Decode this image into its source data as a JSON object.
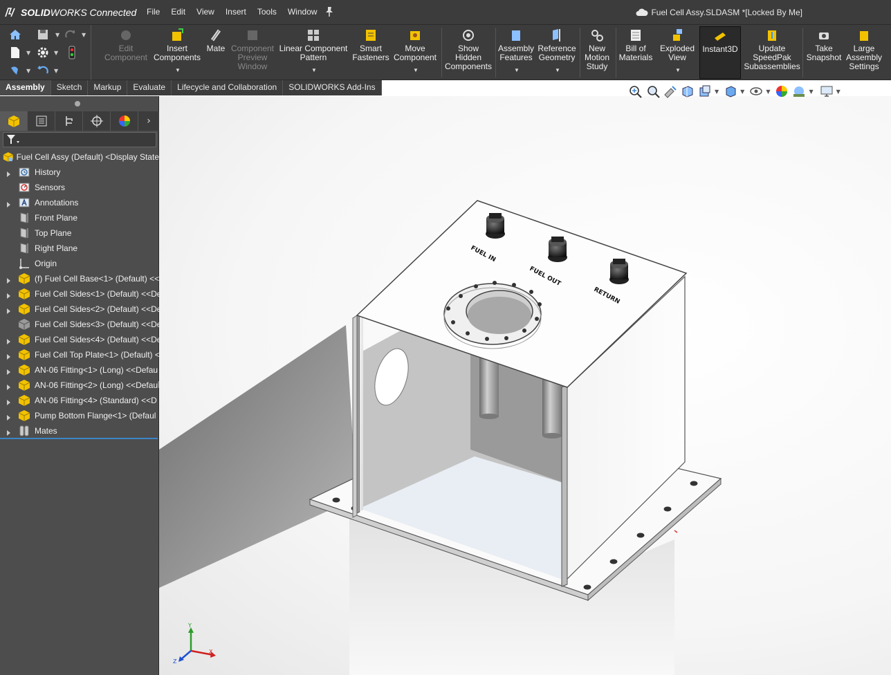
{
  "app": {
    "brand_bold": "SOLID",
    "brand_rest": "WORKS Connected",
    "menu": [
      "File",
      "Edit",
      "View",
      "Insert",
      "Tools",
      "Window"
    ],
    "document_title": "Fuel Cell Assy.SLDASM *[Locked By Me]"
  },
  "commands": [
    {
      "label": "Edit\nComponent",
      "icon": "edit-component-icon",
      "enabled": false
    },
    {
      "label": "Insert\nComponents",
      "icon": "insert-components-icon",
      "enabled": true
    },
    {
      "label": "Mate",
      "icon": "mate-icon",
      "enabled": true
    },
    {
      "label": "Component\nPreview\nWindow",
      "icon": "component-preview-icon",
      "enabled": false
    },
    {
      "label": "Linear Component\nPattern",
      "icon": "linear-pattern-icon",
      "enabled": true
    },
    {
      "label": "Smart\nFasteners",
      "icon": "smart-fasteners-icon",
      "enabled": true
    },
    {
      "label": "Move\nComponent",
      "icon": "move-component-icon",
      "enabled": true
    },
    {
      "label": "Show\nHidden\nComponents",
      "icon": "show-hidden-icon",
      "enabled": true
    },
    {
      "label": "Assembly\nFeatures",
      "icon": "assembly-features-icon",
      "enabled": true
    },
    {
      "label": "Reference\nGeometry",
      "icon": "reference-geometry-icon",
      "enabled": true
    },
    {
      "label": "New\nMotion\nStudy",
      "icon": "motion-study-icon",
      "enabled": true
    },
    {
      "label": "Bill of\nMaterials",
      "icon": "bill-of-materials-icon",
      "enabled": true
    },
    {
      "label": "Exploded\nView",
      "icon": "exploded-view-icon",
      "enabled": true
    },
    {
      "label": "Instant3D",
      "icon": "instant3d-icon",
      "enabled": true,
      "active": true
    },
    {
      "label": "Update\nSpeedPak\nSubassemblies",
      "icon": "speedpak-icon",
      "enabled": true
    },
    {
      "label": "Take\nSnapshot",
      "icon": "camera-icon",
      "enabled": true
    },
    {
      "label": "Large\nAssembly\nSettings",
      "icon": "large-assembly-icon",
      "enabled": true
    }
  ],
  "tabs": [
    "Assembly",
    "Sketch",
    "Markup",
    "Evaluate",
    "Lifecycle and Collaboration",
    "SOLIDWORKS Add-Ins"
  ],
  "active_tab": "Assembly",
  "feature_tree": {
    "root": "Fuel Cell Assy (Default) <Display State",
    "items": [
      {
        "label": "History",
        "icon": "history-icon",
        "expandable": true
      },
      {
        "label": "Sensors",
        "icon": "sensors-icon",
        "expandable": false
      },
      {
        "label": "Annotations",
        "icon": "annotations-icon",
        "expandable": true
      },
      {
        "label": "Front Plane",
        "icon": "plane-icon",
        "expandable": false
      },
      {
        "label": "Top Plane",
        "icon": "plane-icon",
        "expandable": false
      },
      {
        "label": "Right Plane",
        "icon": "plane-icon",
        "expandable": false
      },
      {
        "label": "Origin",
        "icon": "origin-icon",
        "expandable": false
      },
      {
        "label": "(f) Fuel Cell Base<1> (Default) <<",
        "icon": "part-icon",
        "expandable": true
      },
      {
        "label": "Fuel Cell Sides<1> (Default) <<De",
        "icon": "part-icon",
        "expandable": true
      },
      {
        "label": "Fuel Cell Sides<2> (Default) <<De",
        "icon": "part-icon",
        "expandable": true
      },
      {
        "label": "Fuel Cell Sides<3> (Default) <<De",
        "icon": "part-hidden-icon",
        "expandable": false
      },
      {
        "label": "Fuel Cell Sides<4> (Default) <<De",
        "icon": "part-icon",
        "expandable": true
      },
      {
        "label": "Fuel Cell Top Plate<1> (Default) <",
        "icon": "part-icon",
        "expandable": true
      },
      {
        "label": "AN-06 Fitting<1> (Long) <<Defau",
        "icon": "part-icon",
        "expandable": true
      },
      {
        "label": "AN-06 Fitting<2> (Long) <<Defau",
        "icon": "part-icon",
        "expandable": true
      },
      {
        "label": "AN-06 Fitting<4> (Standard) <<D",
        "icon": "part-icon",
        "expandable": true
      },
      {
        "label": "Pump Bottom Flange<1> (Defaul",
        "icon": "part-icon",
        "expandable": true
      },
      {
        "label": "Mates",
        "icon": "mates-icon",
        "expandable": true
      }
    ]
  },
  "model": {
    "labels": {
      "fuel_in": "FUEL IN",
      "fuel_out": "FUEL OUT",
      "return": "RETURN"
    }
  },
  "triad": {
    "x": "X",
    "y": "Y",
    "z": "Z"
  },
  "colors": {
    "chrome": "#3c3c3c",
    "accent": "#3b86c8",
    "part_yellow": "#f2c200"
  }
}
